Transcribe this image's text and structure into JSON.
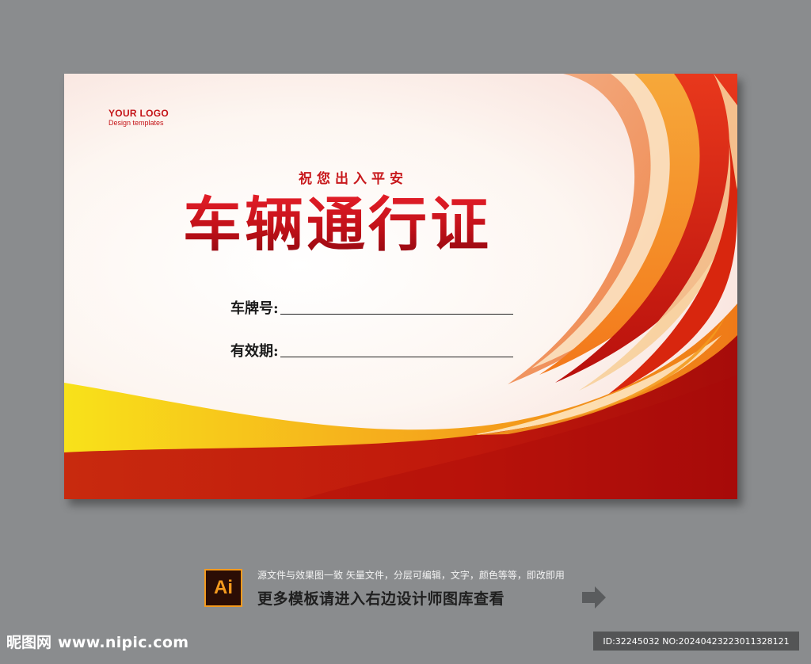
{
  "logo": {
    "name": "YOUR LOGO",
    "tagline": "Design templates"
  },
  "card": {
    "subtitle": "祝您出入平安",
    "title": "车辆通行证",
    "fields": [
      {
        "label": "车牌号:"
      },
      {
        "label": "有效期:"
      }
    ]
  },
  "footer": {
    "file_badge": "Ai",
    "description": "源文件与效果图一致 矢量文件，分层可编辑，文字，颜色等等，即改即用",
    "more_templates": "更多模板请进入右边设计师图库查看",
    "site_name": "昵图网",
    "site_url": "www.nipic.com",
    "image_id": "ID:32245032 NO:20240423223011328121"
  },
  "colors": {
    "page_bg": "#8a8c8e",
    "title_red": "#c41418",
    "band_red": "#c8180e",
    "accent_orange": "#f39a1e",
    "accent_yellow": "#f8d21c"
  }
}
